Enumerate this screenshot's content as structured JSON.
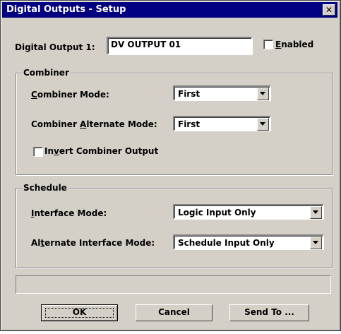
{
  "window": {
    "title": "Digital Outputs - Setup"
  },
  "output": {
    "label": "Digital Output 1:",
    "value": "DV OUTPUT 01",
    "enabled_label": "Enabled",
    "enabled": false
  },
  "combiner": {
    "title": "Combiner",
    "mode_label": "Combiner Mode:",
    "mode_value": "First",
    "alt_mode_label": "Combiner Alternate Mode:",
    "alt_mode_value": "First",
    "invert_label": "Invert Combiner Output",
    "invert": false
  },
  "schedule": {
    "title": "Schedule",
    "interface_label": "Interface Mode:",
    "interface_value": "Logic Input Only",
    "alt_interface_label": "Alternate Interface Mode:",
    "alt_interface_value": "Schedule Input Only"
  },
  "buttons": {
    "ok": "OK",
    "cancel": "Cancel",
    "send_to": "Send To ..."
  },
  "icons": {
    "close": "close-icon",
    "dropdown": "chevron-down-icon"
  }
}
